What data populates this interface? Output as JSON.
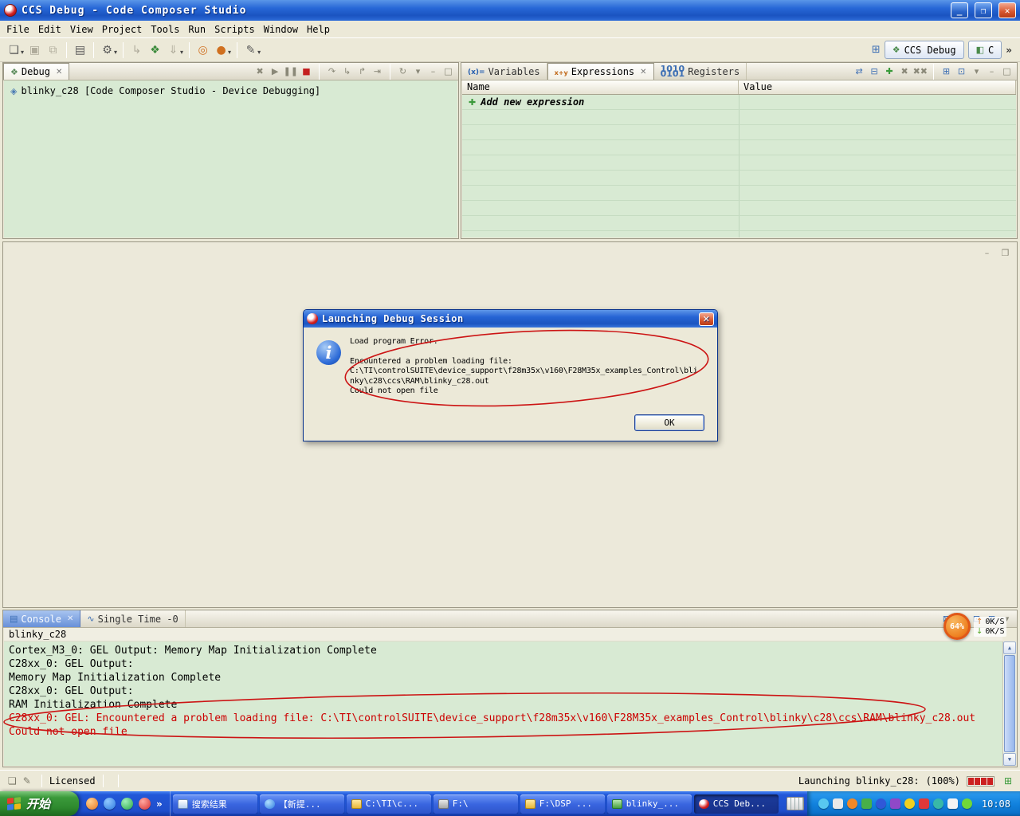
{
  "colors": {
    "error_red": "#CC0000",
    "annotation_red": "#CC1414",
    "content_green": "#D8EAD3",
    "titlebar_blue": "#1C55C0",
    "taskbar_blue": "#1E4ECC",
    "start_green": "#2E8A2E"
  },
  "window": {
    "title": "CCS Debug - Code Composer Studio"
  },
  "menu": {
    "items": [
      "File",
      "Edit",
      "View",
      "Project",
      "Tools",
      "Run",
      "Scripts",
      "Window",
      "Help"
    ]
  },
  "perspective_bar": {
    "debug_label": "CCS Debug",
    "cpp_label": "C"
  },
  "debug_view": {
    "tab_label": "Debug",
    "tree_item": "blinky_c28 [Code Composer Studio - Device Debugging]"
  },
  "expressions_view": {
    "tab_variables": "Variables",
    "tab_expressions": "Expressions",
    "tab_registers": "Registers",
    "col_name": "Name",
    "col_value": "Value",
    "add_row_label": "Add new expression"
  },
  "dialog": {
    "title": "Launching Debug Session",
    "message_lines": [
      "Load program Error.",
      "",
      "Encountered a problem loading file:",
      "C:\\TI\\controlSUITE\\device_support\\f28m35x\\v160\\F28M35x_examples_Control\\bli",
      "nky\\c28\\ccs\\RAM\\blinky_c28.out",
      "Could not open file"
    ],
    "ok_label": "OK"
  },
  "console_view": {
    "tab_console": "Console",
    "tab_single_time": "Single Time -0",
    "source_label": "blinky_c28",
    "lines": [
      {
        "text": "Cortex_M3_0: GEL Output: Memory Map Initialization Complete",
        "cls": ""
      },
      {
        "text": "C28xx_0: GEL Output: ",
        "cls": ""
      },
      {
        "text": "Memory Map Initialization Complete",
        "cls": ""
      },
      {
        "text": "C28xx_0: GEL Output: ",
        "cls": ""
      },
      {
        "text": "RAM Initialization Complete",
        "cls": ""
      },
      {
        "text": "C28xx_0: GEL: Encountered a problem loading file: C:\\TI\\controlSUITE\\device_support\\f28m35x\\v160\\F28M35x_examples_Control\\blinky\\c28\\ccs\\RAM\\blinky_c28.out",
        "cls": "red"
      },
      {
        "text": "Could not open file",
        "cls": "red"
      }
    ]
  },
  "status_bar": {
    "licensed": "Licensed",
    "progress_label": "Launching blinky_c28:",
    "progress_percent": "(100%)"
  },
  "speed_monitor": {
    "percent": "64%",
    "up_speed": "0K/S",
    "down_speed": "0K/S"
  },
  "taskbar": {
    "start_label": "开始",
    "tasks": [
      {
        "label": "搜索结果",
        "icon": "i-doc",
        "state": ""
      },
      {
        "label": "【新提...",
        "icon": "i-globe",
        "state": ""
      },
      {
        "label": "C:\\TI\\c...",
        "icon": "i-folder",
        "state": ""
      },
      {
        "label": "F:\\",
        "icon": "i-drive",
        "state": ""
      },
      {
        "label": "F:\\DSP ...",
        "icon": "i-folder",
        "state": ""
      },
      {
        "label": "blinky_...",
        "icon": "i-app",
        "state": ""
      },
      {
        "label": "CCS Deb...",
        "icon": "i-ccs",
        "state": "active"
      }
    ],
    "clock": "10:08"
  }
}
